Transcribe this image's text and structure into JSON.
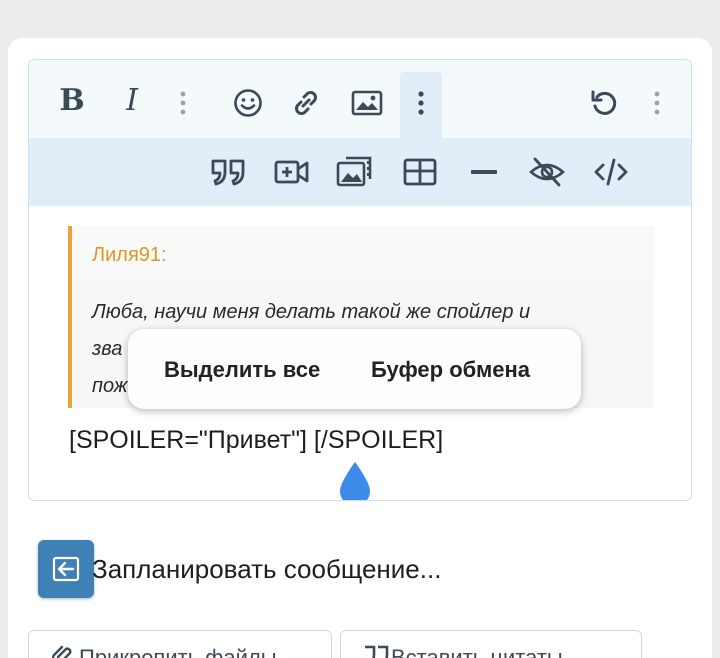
{
  "toolbar": {
    "row1": [
      {
        "name": "bold-button",
        "label": "B"
      },
      {
        "name": "italic-button",
        "label": "I"
      },
      {
        "name": "more-text-options-icon"
      },
      {
        "name": "emoji-icon"
      },
      {
        "name": "link-icon"
      },
      {
        "name": "image-icon"
      },
      {
        "name": "more-insert-options-icon"
      },
      {
        "name": "undo-icon"
      },
      {
        "name": "more-options-icon"
      }
    ],
    "row2": [
      "quote-icon",
      "insert-video-icon",
      "media-gallery-icon",
      "table-icon",
      "horizontal-line-icon",
      "spoiler-hide-icon",
      "code-icon"
    ]
  },
  "quote": {
    "author": "Лиля91:",
    "line1": "Люба, научи меня делать такой же спойлер и",
    "line2_visible": "зва",
    "line3_visible": "пож"
  },
  "editor": {
    "spoiler_text": "[SPOILER=\"Привет\"]   [/SPOILER]"
  },
  "context_menu": {
    "select_all": "Выделить все",
    "clipboard": "Буфер обмена"
  },
  "schedule": {
    "label": "Запланировать сообщение..."
  },
  "bottom_buttons": {
    "attach_label": "Прикрепить файлы",
    "quote_label": "Вставить цитаты"
  },
  "colors": {
    "accent": "#3f80b6",
    "quote_border": "#e6a43a",
    "quote_author": "#e0961f",
    "cursor": "#3d8be8"
  }
}
